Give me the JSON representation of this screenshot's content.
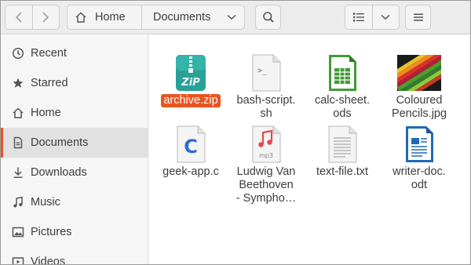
{
  "header": {
    "back_icon": "chevron-left-icon",
    "forward_icon": "chevron-right-icon",
    "path": [
      {
        "label": "Home",
        "icon": "home-icon"
      },
      {
        "label": "Documents",
        "icon": "chevron-down-icon"
      }
    ],
    "search_icon": "search-icon",
    "view_icon": "list-view-icon",
    "view_menu_icon": "chevron-down-icon",
    "menu_icon": "hamburger-menu-icon"
  },
  "sidebar": {
    "items": [
      {
        "label": "Recent",
        "icon": "clock-icon"
      },
      {
        "label": "Starred",
        "icon": "star-icon"
      },
      {
        "label": "Home",
        "icon": "home-icon"
      },
      {
        "label": "Documents",
        "icon": "document-icon",
        "active": true
      },
      {
        "label": "Downloads",
        "icon": "download-icon"
      },
      {
        "label": "Music",
        "icon": "music-icon"
      },
      {
        "label": "Pictures",
        "icon": "picture-icon"
      },
      {
        "label": "Videos",
        "icon": "video-icon"
      }
    ]
  },
  "files": [
    {
      "name": "archive.zip",
      "icon": "zip-archive-icon",
      "selected": true
    },
    {
      "name": "bash-script.\nsh",
      "icon": "script-file-icon"
    },
    {
      "name": "calc-sheet.\nods",
      "icon": "spreadsheet-file-icon"
    },
    {
      "name": "Coloured\nPencils.jpg",
      "icon": "image-thumbnail-icon"
    },
    {
      "name": "geek-app.c",
      "icon": "c-source-file-icon"
    },
    {
      "name": "Ludwig Van\nBeethoven\n- Sympho…",
      "icon": "music-file-icon",
      "sublabel": "mp3"
    },
    {
      "name": "text-file.txt",
      "icon": "text-file-icon"
    },
    {
      "name": "writer-doc.\nodt",
      "icon": "document-file-icon"
    }
  ],
  "colors": {
    "accent": "#e95420",
    "zip": "#2aa198",
    "calc": "#3e9c35",
    "writer": "#1f6bb5",
    "c_file": "#2d6bd6",
    "music": "#e5484d"
  }
}
